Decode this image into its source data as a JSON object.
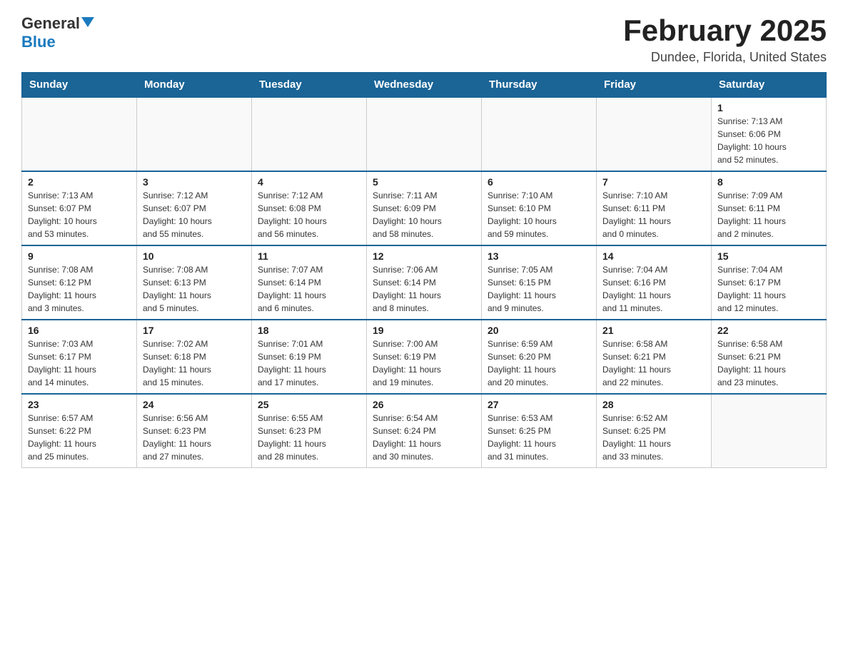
{
  "header": {
    "logo_general": "General",
    "logo_blue": "Blue",
    "month_title": "February 2025",
    "location": "Dundee, Florida, United States"
  },
  "weekdays": [
    "Sunday",
    "Monday",
    "Tuesday",
    "Wednesday",
    "Thursday",
    "Friday",
    "Saturday"
  ],
  "weeks": [
    [
      {
        "day": "",
        "info": ""
      },
      {
        "day": "",
        "info": ""
      },
      {
        "day": "",
        "info": ""
      },
      {
        "day": "",
        "info": ""
      },
      {
        "day": "",
        "info": ""
      },
      {
        "day": "",
        "info": ""
      },
      {
        "day": "1",
        "info": "Sunrise: 7:13 AM\nSunset: 6:06 PM\nDaylight: 10 hours\nand 52 minutes."
      }
    ],
    [
      {
        "day": "2",
        "info": "Sunrise: 7:13 AM\nSunset: 6:07 PM\nDaylight: 10 hours\nand 53 minutes."
      },
      {
        "day": "3",
        "info": "Sunrise: 7:12 AM\nSunset: 6:07 PM\nDaylight: 10 hours\nand 55 minutes."
      },
      {
        "day": "4",
        "info": "Sunrise: 7:12 AM\nSunset: 6:08 PM\nDaylight: 10 hours\nand 56 minutes."
      },
      {
        "day": "5",
        "info": "Sunrise: 7:11 AM\nSunset: 6:09 PM\nDaylight: 10 hours\nand 58 minutes."
      },
      {
        "day": "6",
        "info": "Sunrise: 7:10 AM\nSunset: 6:10 PM\nDaylight: 10 hours\nand 59 minutes."
      },
      {
        "day": "7",
        "info": "Sunrise: 7:10 AM\nSunset: 6:11 PM\nDaylight: 11 hours\nand 0 minutes."
      },
      {
        "day": "8",
        "info": "Sunrise: 7:09 AM\nSunset: 6:11 PM\nDaylight: 11 hours\nand 2 minutes."
      }
    ],
    [
      {
        "day": "9",
        "info": "Sunrise: 7:08 AM\nSunset: 6:12 PM\nDaylight: 11 hours\nand 3 minutes."
      },
      {
        "day": "10",
        "info": "Sunrise: 7:08 AM\nSunset: 6:13 PM\nDaylight: 11 hours\nand 5 minutes."
      },
      {
        "day": "11",
        "info": "Sunrise: 7:07 AM\nSunset: 6:14 PM\nDaylight: 11 hours\nand 6 minutes."
      },
      {
        "day": "12",
        "info": "Sunrise: 7:06 AM\nSunset: 6:14 PM\nDaylight: 11 hours\nand 8 minutes."
      },
      {
        "day": "13",
        "info": "Sunrise: 7:05 AM\nSunset: 6:15 PM\nDaylight: 11 hours\nand 9 minutes."
      },
      {
        "day": "14",
        "info": "Sunrise: 7:04 AM\nSunset: 6:16 PM\nDaylight: 11 hours\nand 11 minutes."
      },
      {
        "day": "15",
        "info": "Sunrise: 7:04 AM\nSunset: 6:17 PM\nDaylight: 11 hours\nand 12 minutes."
      }
    ],
    [
      {
        "day": "16",
        "info": "Sunrise: 7:03 AM\nSunset: 6:17 PM\nDaylight: 11 hours\nand 14 minutes."
      },
      {
        "day": "17",
        "info": "Sunrise: 7:02 AM\nSunset: 6:18 PM\nDaylight: 11 hours\nand 15 minutes."
      },
      {
        "day": "18",
        "info": "Sunrise: 7:01 AM\nSunset: 6:19 PM\nDaylight: 11 hours\nand 17 minutes."
      },
      {
        "day": "19",
        "info": "Sunrise: 7:00 AM\nSunset: 6:19 PM\nDaylight: 11 hours\nand 19 minutes."
      },
      {
        "day": "20",
        "info": "Sunrise: 6:59 AM\nSunset: 6:20 PM\nDaylight: 11 hours\nand 20 minutes."
      },
      {
        "day": "21",
        "info": "Sunrise: 6:58 AM\nSunset: 6:21 PM\nDaylight: 11 hours\nand 22 minutes."
      },
      {
        "day": "22",
        "info": "Sunrise: 6:58 AM\nSunset: 6:21 PM\nDaylight: 11 hours\nand 23 minutes."
      }
    ],
    [
      {
        "day": "23",
        "info": "Sunrise: 6:57 AM\nSunset: 6:22 PM\nDaylight: 11 hours\nand 25 minutes."
      },
      {
        "day": "24",
        "info": "Sunrise: 6:56 AM\nSunset: 6:23 PM\nDaylight: 11 hours\nand 27 minutes."
      },
      {
        "day": "25",
        "info": "Sunrise: 6:55 AM\nSunset: 6:23 PM\nDaylight: 11 hours\nand 28 minutes."
      },
      {
        "day": "26",
        "info": "Sunrise: 6:54 AM\nSunset: 6:24 PM\nDaylight: 11 hours\nand 30 minutes."
      },
      {
        "day": "27",
        "info": "Sunrise: 6:53 AM\nSunset: 6:25 PM\nDaylight: 11 hours\nand 31 minutes."
      },
      {
        "day": "28",
        "info": "Sunrise: 6:52 AM\nSunset: 6:25 PM\nDaylight: 11 hours\nand 33 minutes."
      },
      {
        "day": "",
        "info": ""
      }
    ]
  ]
}
